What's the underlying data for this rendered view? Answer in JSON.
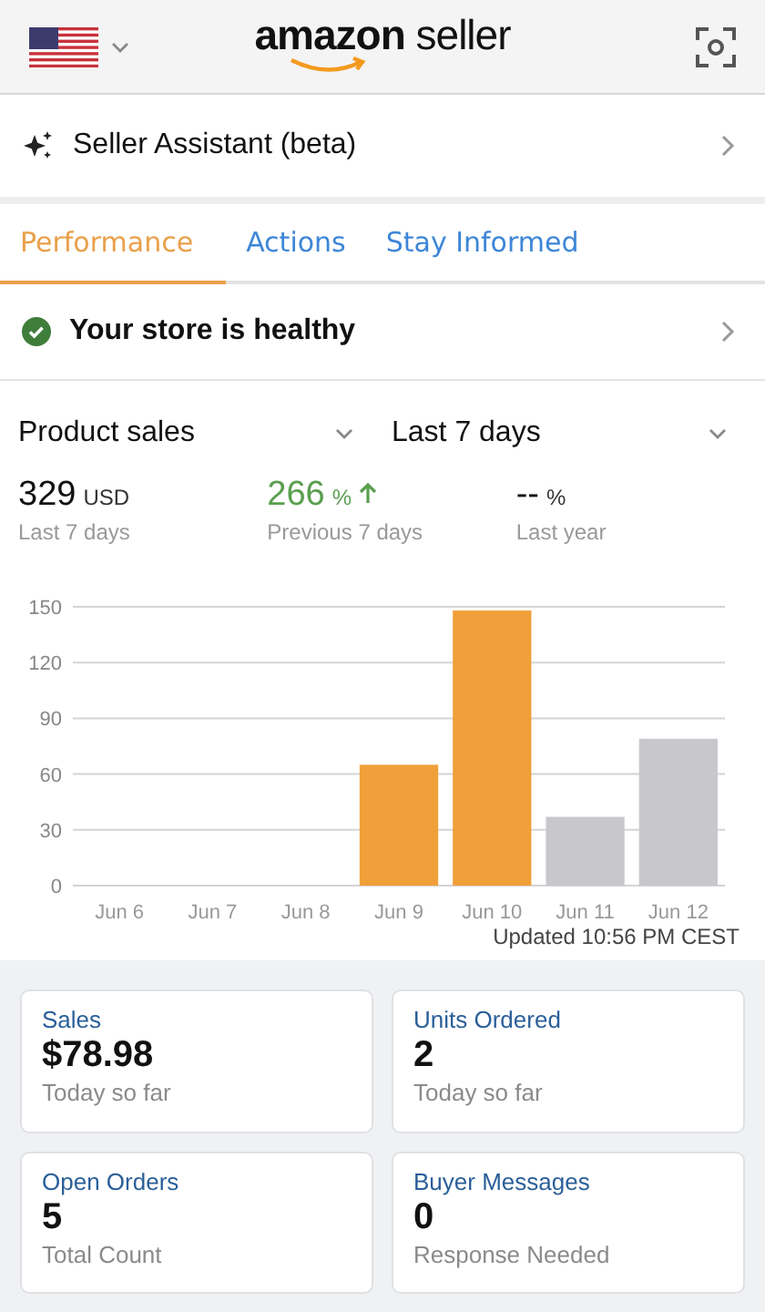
{
  "header": {
    "logo": "**amazon** seller"
  },
  "assistant": {
    "label": "Seller Assistant (beta)"
  },
  "tabs": [
    {
      "label": "Performance",
      "selected": true
    },
    {
      "label": "Actions",
      "selected": false
    },
    {
      "label": "Stay Informed",
      "selected": false
    }
  ],
  "health": {
    "label": "Your store is healthy",
    "healthy": true
  },
  "filters": [
    {
      "value": "Product sales"
    },
    {
      "value": "Last 7 days"
    }
  ],
  "stats": [
    {
      "value": "329",
      "unit": "USD",
      "label": "Last 7 days",
      "kind": "plain"
    },
    {
      "value": "266",
      "unit": "%",
      "label": "Previous 7 days",
      "kind": "up"
    },
    {
      "value": "--",
      "unit": "%",
      "label": "Last year",
      "kind": "plain"
    }
  ],
  "chart": {
    "chart_data": {
      "type": "bar",
      "categories": [
        "Jun 6",
        "Jun 7",
        "Jun 8",
        "Jun 9",
        "Jun 10",
        "Jun 11",
        "Jun 12"
      ],
      "series": [
        {
          "color": "#f0a03a",
          "values": [
            0,
            0,
            0,
            65,
            148,
            null,
            null
          ]
        },
        {
          "color": "#c8c8cc",
          "values": [
            null,
            null,
            null,
            null,
            null,
            37,
            79
          ]
        }
      ],
      "ylim": [
        0,
        150
      ],
      "grid": true,
      "yticks": [
        0,
        30,
        60,
        90,
        120,
        150
      ],
      "stacked": true
    },
    "updated": "Updated 10:56 PM CEST"
  },
  "cards": [
    {
      "title": "Sales",
      "value": "$78.98",
      "note": "Today so far"
    },
    {
      "title": "Units Ordered",
      "value": "2",
      "note": "Today so far"
    },
    {
      "title": "Open Orders",
      "value": "5",
      "note": "Total Count"
    },
    {
      "title": "Buyer Messages",
      "value": "0",
      "note": "Response Needed"
    }
  ]
}
